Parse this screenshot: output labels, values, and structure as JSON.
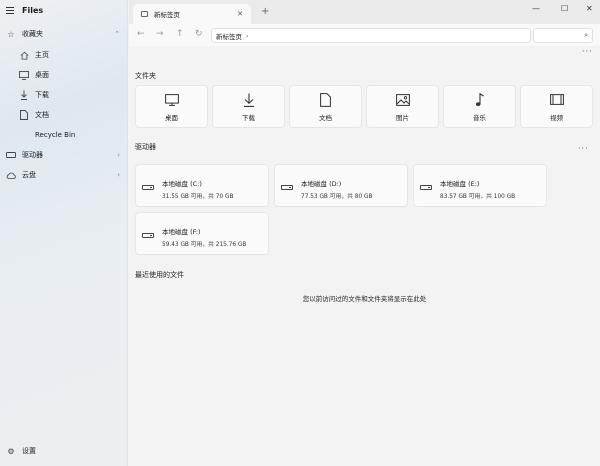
{
  "app": {
    "title": "Files"
  },
  "sidebar": {
    "favorites_label": "收藏夹",
    "items": [
      {
        "label": "主页",
        "icon": "home-icon"
      },
      {
        "label": "桌面",
        "icon": "desktop-icon"
      },
      {
        "label": "下载",
        "icon": "download-icon"
      },
      {
        "label": "文档",
        "icon": "document-icon"
      },
      {
        "label": "Recycle Bin",
        "icon": "recycle-bin-icon"
      }
    ],
    "drives_label": "驱动器",
    "cloud_label": "云盘",
    "settings_label": "设置"
  },
  "tabs": [
    {
      "label": "新标签页"
    }
  ],
  "address": {
    "path": "新标签页"
  },
  "folders": {
    "title": "文件夹",
    "items": [
      {
        "label": "桌面",
        "icon": "desktop-icon"
      },
      {
        "label": "下载",
        "icon": "download-icon"
      },
      {
        "label": "文档",
        "icon": "document-icon"
      },
      {
        "label": "图片",
        "icon": "picture-icon"
      },
      {
        "label": "音乐",
        "icon": "music-icon"
      },
      {
        "label": "视频",
        "icon": "video-icon"
      }
    ]
  },
  "drives": {
    "title": "驱动器",
    "items": [
      {
        "name": "本地磁盘 (C:)",
        "size": "31.55 GB 可用，共 70 GB"
      },
      {
        "name": "本地磁盘 (D:)",
        "size": "77.53 GB 可用，共 80 GB"
      },
      {
        "name": "本地磁盘 (E:)",
        "size": "83.57 GB 可用，共 100 GB"
      },
      {
        "name": "本地磁盘 (F:)",
        "size": "59.43 GB 可用，共 215.76 GB"
      }
    ]
  },
  "recent": {
    "title": "最近使用的文件",
    "empty_message": "您以前访问过的文件和文件夹将显示在此处"
  }
}
